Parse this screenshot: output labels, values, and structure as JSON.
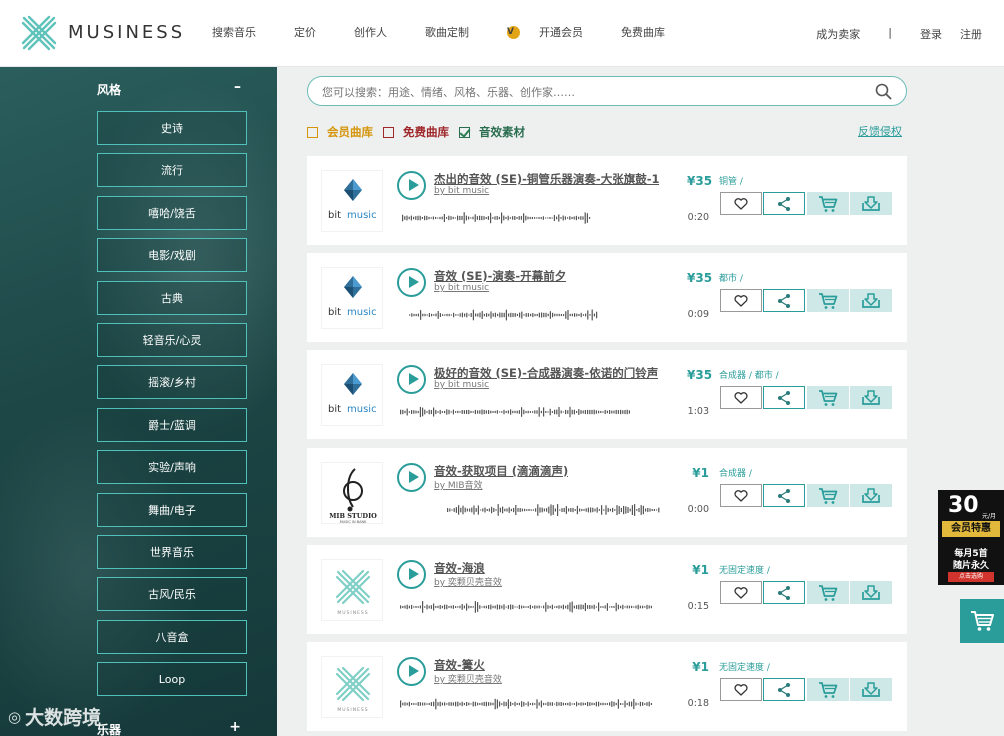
{
  "header": {
    "brand": "MUSINESS",
    "nav": [
      {
        "label": "搜索音乐",
        "state": "active"
      },
      {
        "label": "定价",
        "state": "normal"
      },
      {
        "label": "创作人",
        "state": "normal"
      },
      {
        "label": "歌曲定制",
        "state": "normal"
      },
      {
        "label": "开通会员",
        "state": "vip"
      },
      {
        "label": "免费曲库",
        "state": "free"
      }
    ],
    "vip_badge": "V",
    "become_seller": "成为卖家",
    "separator": "|",
    "login": "登录",
    "register": "注册"
  },
  "sidebar": {
    "section_title": "风格",
    "collapse_symbol": "–",
    "items": [
      "史诗",
      "流行",
      "嘻哈/饶舌",
      "电影/戏剧",
      "古典",
      "轻音乐/心灵",
      "摇滚/乡村",
      "爵士/蓝调",
      "实验/声响",
      "舞曲/电子",
      "世界音乐",
      "古风/民乐",
      "八音盒",
      "Loop"
    ],
    "next_section_title": "乐器",
    "expand_symbol": "+",
    "watermark": "大数跨境"
  },
  "search": {
    "placeholder": "您可以搜索：用途、情绪、风格、乐器、创作家……"
  },
  "filters": [
    {
      "label": "会员曲库",
      "checked": false,
      "variant": "vip"
    },
    {
      "label": "免费曲库",
      "checked": false,
      "variant": "free"
    },
    {
      "label": "音效素材",
      "checked": true,
      "variant": "fx"
    }
  ],
  "report_link": "反馈侵权",
  "tracks": [
    {
      "title": "杰出的音效 (SE)-铜管乐器演奏-大张旗鼓-1",
      "by": "by bit music",
      "price": "¥35",
      "duration": "0:20",
      "tags": "铜管 /",
      "cover": "bit"
    },
    {
      "title": "音效 (SE)-演奏-开幕前夕",
      "by": "by bit music",
      "price": "¥35",
      "duration": "0:09",
      "tags": "都市 /",
      "cover": "bit"
    },
    {
      "title": "极好的音效 (SE)-合成器演奏-依诺的门铃声",
      "by": "by bit music",
      "price": "¥35",
      "duration": "1:03",
      "tags": "合成器 / 都市 /",
      "cover": "bit"
    },
    {
      "title": "音效-获取项目 (滴滴滴声)",
      "by": "by MIB音效",
      "price": "¥1",
      "duration": "0:00",
      "tags": "合成器 /",
      "cover": "mib"
    },
    {
      "title": "音效-海浪",
      "by": "by 奕颗贝壳音效",
      "price": "¥1",
      "duration": "0:15",
      "tags": "无固定速度 /",
      "cover": "musiness"
    },
    {
      "title": "音效-篝火",
      "by": "by 奕颗贝壳音效",
      "price": "¥1",
      "duration": "0:18",
      "tags": "无固定速度 /",
      "cover": "musiness"
    }
  ],
  "cover_text": {
    "bit_a": "bit",
    "bit_b": "music",
    "mib_a": "MIB STUDIO",
    "mib_b": "MUSIC IN BANK",
    "musiness": "MUSINESS"
  },
  "promo": {
    "number": "30",
    "unit": "元/月",
    "tag": "会员特惠",
    "line1": "每月5首",
    "line2": "随片永久",
    "cta": "点击选购"
  },
  "colors": {
    "accent": "#2a9d9a",
    "vip": "#d4950b",
    "free": "#c0392b",
    "sidebar": "#1d4746"
  }
}
